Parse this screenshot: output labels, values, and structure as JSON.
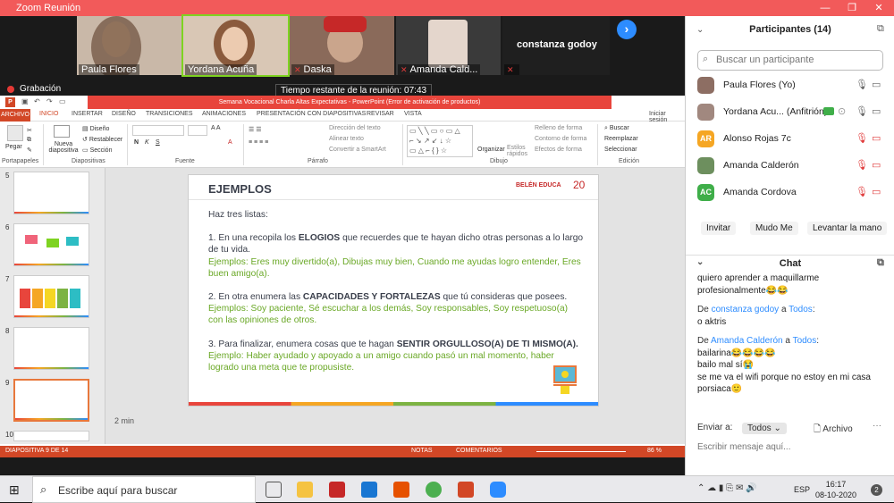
{
  "window": {
    "title": "Zoom Reunión",
    "recording_label": "Grabación",
    "timer_text": "Tiempo restante de la reunión: 07:43"
  },
  "videos": [
    {
      "name": "Paula Flores"
    },
    {
      "name": "Yordana Acuña"
    },
    {
      "name": "Daska"
    },
    {
      "name": "Amanda Cald..."
    },
    {
      "name": "constanza godoy"
    }
  ],
  "ppt": {
    "title": "Semana Vocacional Charla Altas Expectativas - PowerPoint (Error de activación de productos)",
    "tabs": [
      "ARCHIVO",
      "INICIO",
      "INSERTAR",
      "DISEÑO",
      "TRANSICIONES",
      "ANIMACIONES",
      "PRESENTACIÓN CON DIAPOSITIVAS",
      "REVISAR",
      "VISTA"
    ],
    "signin": "Iniciar sesión",
    "ribbon": {
      "paste": "Pegar",
      "new_slide": "Nueva diapositiva",
      "layout": "Diseño",
      "reset": "Restablecer",
      "section": "Sección",
      "text_direction": "Dirección del texto",
      "align_text": "Alinear texto",
      "smartart": "Convertir a SmartArt",
      "arrange": "Organizar",
      "quick_styles": "Estilos rápidos",
      "shape_fill": "Relleno de forma",
      "shape_outline": "Contorno de forma",
      "shape_effects": "Efectos de forma",
      "find": "Buscar",
      "replace": "Reemplazar",
      "select": "Seleccionar",
      "groups": [
        "Portapapeles",
        "Diapositivas",
        "Fuente",
        "Párrafo",
        "Dibujo",
        "Edición"
      ]
    },
    "thumb_numbers": [
      "5",
      "6",
      "7",
      "8",
      "9",
      "10"
    ],
    "notes_text": "2 min",
    "status": {
      "slide": "DIAPOSITIVA 9 DE 14",
      "notes": "NOTAS",
      "comments": "COMENTARIOS",
      "zoom": "86 %"
    }
  },
  "slide": {
    "title": "EJEMPLOS",
    "logo": "BELÉN EDUCA",
    "logo_num": "20",
    "intro": "Haz tres listas:",
    "p1a": "1. En una recopila los ",
    "p1b": "ELOGIOS",
    "p1c": " que recuerdes que te hayan dicho otras personas a lo largo de tu vida.",
    "ex1": "Ejemplos: Eres muy divertido(a), Dibujas muy bien, Cuando me ayudas logro entender, Eres buen amigo(a).",
    "p2a": "2. En otra enumera las ",
    "p2b": "CAPACIDADES Y FORTALEZAS",
    "p2c": " que tú consideras que posees.",
    "ex2": "Ejemplos: Soy paciente, Sé escuchar a los demás, Soy responsables, Soy respetuoso(a) con las opiniones de otros.",
    "p3a": "3. Para finalizar,  enumera cosas que te hagan ",
    "p3b": "SENTIR ORGULLOSO(A) DE TI MISMO(A).",
    "ex3": "Ejemplo: Haber ayudado y apoyado a un amigo cuando pasó un mal momento, haber logrado una meta que te propusiste."
  },
  "panel": {
    "participants_title": "Participantes (14)",
    "search_placeholder": "Buscar un participante",
    "participants": [
      {
        "name": "Paula Flores (Yo)",
        "initials": "",
        "color": "#8d6e63"
      },
      {
        "name": "Yordana Acu...  (Anfitrión)",
        "initials": "",
        "color": "#a1887f"
      },
      {
        "name": "Alonso Rojas 7c",
        "initials": "AR",
        "color": "#f5a623"
      },
      {
        "name": "Amanda Calderón",
        "initials": "",
        "color": "#6d8f5e"
      },
      {
        "name": "Amanda Cordova",
        "initials": "AC",
        "color": "#3fae49"
      }
    ],
    "buttons": {
      "invite": "Invitar",
      "mute_me": "Mudo Me",
      "raise_hand": "Levantar la mano"
    },
    "chat_title": "Chat",
    "chat_top": "quiero aprender a maquillarme profesionalmente😂😂",
    "chat": [
      {
        "prefix": "De ",
        "from": "constanza godoy",
        "mid": " a ",
        "to": "Todos",
        "suffix": ":",
        "lines": [
          "o aktris"
        ]
      },
      {
        "prefix": "De ",
        "from": "Amanda Calderón",
        "mid": " a ",
        "to": "Todos",
        "suffix": ":",
        "lines": [
          "bailarina😂😂😂😂",
          "bailo mal sí😭",
          "se me va el wifi porque no estoy en mi casa",
          "porsiaca🙂"
        ]
      }
    ],
    "send_to_label": "Enviar a:",
    "send_to_value": "Todos",
    "file_label": "Archivo",
    "input_placeholder": "Escribir mensaje aquí..."
  },
  "taskbar": {
    "search": "Escribe aquí para buscar",
    "lang": "ESP",
    "time": "16:17",
    "date": "08-10-2020",
    "notif": "2"
  },
  "colors": {
    "accent": "#2d8cff",
    "ppt_red": "#d24726",
    "zoom_title": "#f25a5a",
    "green_text": "#6aa826"
  }
}
